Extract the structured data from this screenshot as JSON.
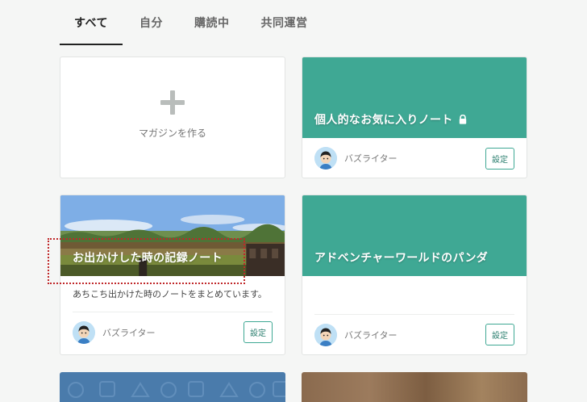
{
  "tabs": [
    {
      "label": "すべて",
      "active": true
    },
    {
      "label": "自分",
      "active": false
    },
    {
      "label": "購読中",
      "active": false
    },
    {
      "label": "共同運営",
      "active": false
    }
  ],
  "create_card": {
    "label": "マガジンを作る",
    "icon": "plus-icon"
  },
  "magazines": [
    {
      "title": "個人的なお気に入りノート",
      "locked": true,
      "description": "",
      "author": "バズライター",
      "settings_label": "設定",
      "cover": "teal"
    },
    {
      "title": "お出かけした時の記録ノート",
      "locked": false,
      "description": "あちこち出かけた時のノートをまとめています。",
      "author": "バズライター",
      "settings_label": "設定",
      "cover": "photo"
    },
    {
      "title": "アドベンチャーワールドのパンダ",
      "locked": false,
      "description": "",
      "author": "バズライター",
      "settings_label": "設定",
      "cover": "teal"
    }
  ],
  "colors": {
    "accent": "#3fa894",
    "selection": "#c0282a",
    "background": "#f5f6f5"
  }
}
